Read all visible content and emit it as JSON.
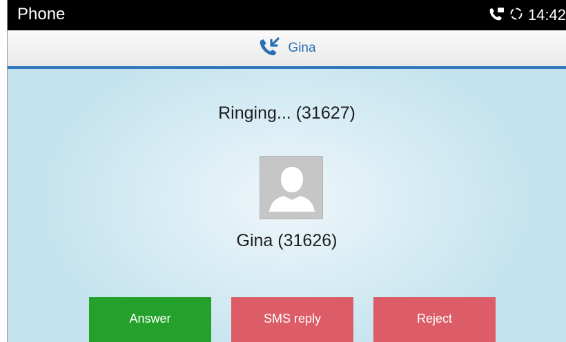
{
  "status_bar": {
    "title": "Phone",
    "time": "14:42",
    "icons": [
      "voicemail-call-icon",
      "sync-icon"
    ]
  },
  "header": {
    "caller_name": "Gina",
    "icon": "incoming-call-icon",
    "accent_color": "#2f78be"
  },
  "call": {
    "status_text": "Ringing... (31627)",
    "caller_text": "Gina (31626)",
    "avatar_icon": "person-placeholder-icon"
  },
  "actions": {
    "answer_label": "Answer",
    "sms_label": "SMS reply",
    "reject_label": "Reject",
    "answer_color": "#24a12a",
    "reject_color": "#dc5d67"
  }
}
